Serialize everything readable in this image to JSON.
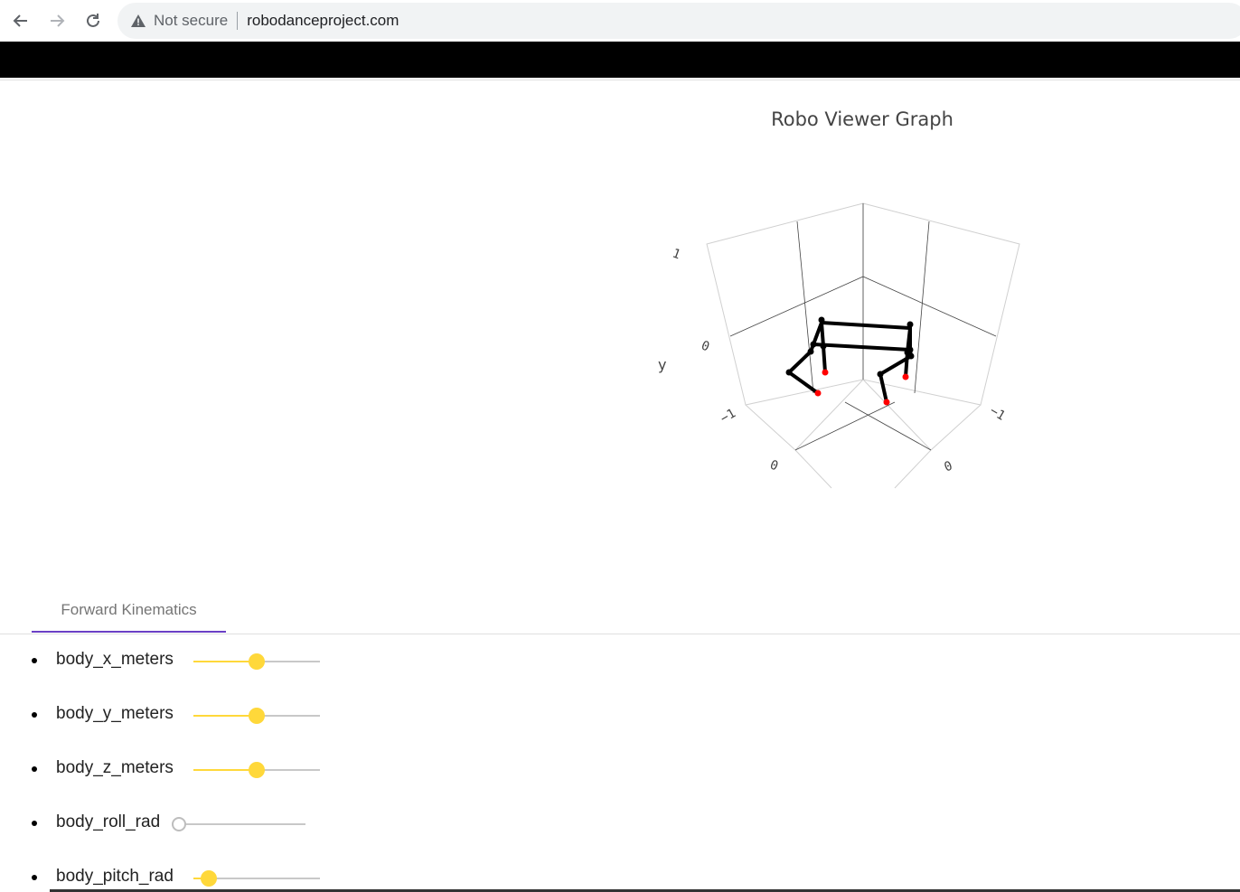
{
  "browser": {
    "security_label": "Not secure",
    "url": "robodanceproject.com"
  },
  "graph": {
    "title": "Robo Viewer Graph",
    "axis_label_y": "y",
    "tick_labels": {
      "vertical_top": "1",
      "vertical_mid": "0",
      "left_low": "−1",
      "left_front": "0",
      "right_low": "−1",
      "right_front": "0"
    },
    "colors": {
      "body_lines": "#000000",
      "joints": "#000000",
      "feet": "#ff0000",
      "grid": "#cccccc"
    }
  },
  "tabs": [
    {
      "label": "Forward Kinematics",
      "selected": true
    }
  ],
  "sliders": [
    {
      "label": "body_x_meters",
      "value_fraction": 0.5
    },
    {
      "label": "body_y_meters",
      "value_fraction": 0.5
    },
    {
      "label": "body_z_meters",
      "value_fraction": 0.5
    },
    {
      "label": "body_roll_rad",
      "value_fraction": 0.0
    },
    {
      "label": "body_pitch_rad",
      "value_fraction": 0.12
    }
  ],
  "colors": {
    "accent": "#ffd83a",
    "tab_indicator": "#6a3fc5"
  }
}
